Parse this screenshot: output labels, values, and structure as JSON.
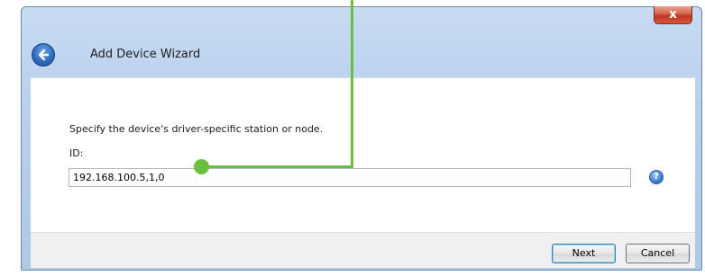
{
  "window": {
    "close_label": "x",
    "title": "Add Device Wizard"
  },
  "icons": {
    "back": "back-arrow-icon",
    "help": "help-icon",
    "close": "close-icon"
  },
  "main": {
    "instruction": "Specify the device's driver-specific station or node.",
    "id_label": "ID:",
    "id_value": "192.168.100.5,1,0",
    "help_glyph": "?"
  },
  "footer": {
    "next_label": "Next",
    "cancel_label": "Cancel"
  },
  "colors": {
    "callout": "#6bbf3b",
    "title_bar": "#b8d0ec"
  }
}
